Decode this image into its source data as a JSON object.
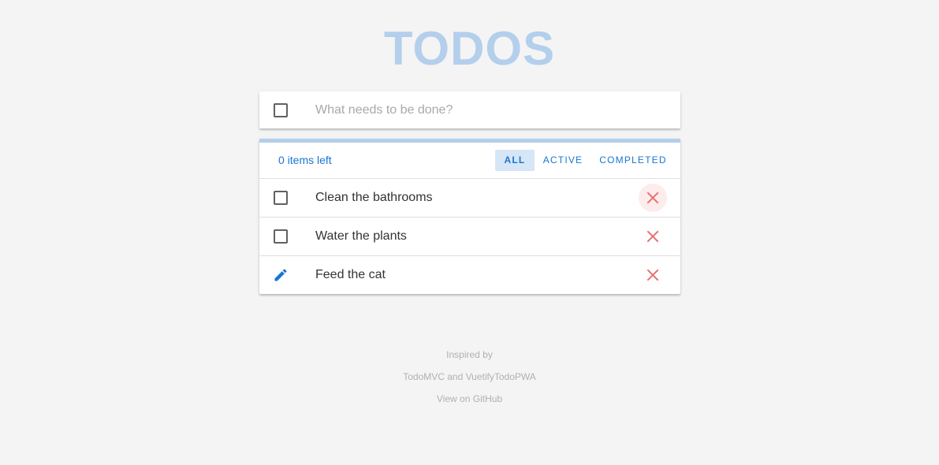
{
  "app": {
    "title": "TODOS"
  },
  "new_todo": {
    "placeholder": "What needs to be done?",
    "value": ""
  },
  "toolbar": {
    "items_left": "0 items left",
    "filters": [
      {
        "label": "ALL",
        "selected": true
      },
      {
        "label": "ACTIVE",
        "selected": false
      },
      {
        "label": "COMPLETED",
        "selected": false
      }
    ]
  },
  "todos": [
    {
      "text": "Clean the bathrooms",
      "completed": false,
      "editing": false
    },
    {
      "text": "Water the plants",
      "completed": false,
      "editing": false
    },
    {
      "text": "Feed the cat",
      "completed": false,
      "editing": true
    }
  ],
  "footer": {
    "inspired_by": "Inspired by",
    "sources": "TodoMVC and VuetifyTodoPWA",
    "github": "View on GitHub"
  },
  "colors": {
    "accent": "#1976d2",
    "title": "#b3cfec",
    "delete": "#e57373",
    "background": "#f4f4f4"
  }
}
